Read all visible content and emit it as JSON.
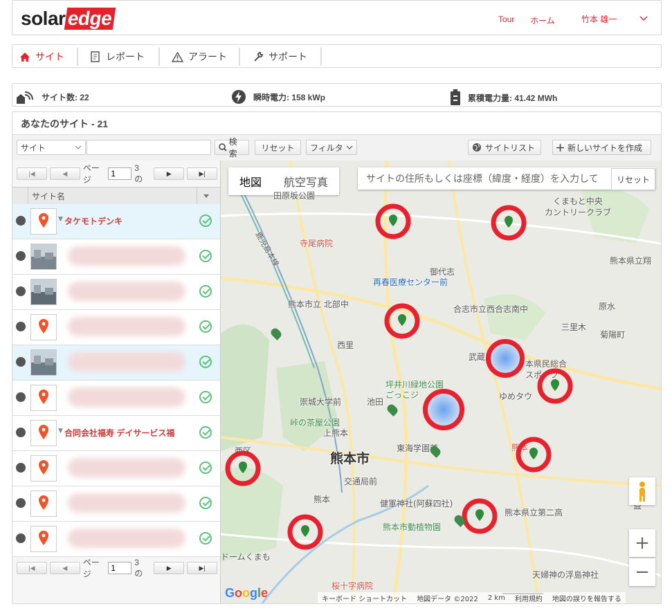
{
  "header": {
    "logo_solar": "solar",
    "logo_edge": "edge",
    "tour": "Tour",
    "home": "ホーム",
    "user": "竹本 雄一",
    "chevron": "chevron-down-icon"
  },
  "nav": {
    "site": "サイト",
    "report": "レポート",
    "alert": "アラート",
    "support": "サポート"
  },
  "stats": {
    "sites": "サイト数: 22",
    "power": "瞬時電力: 158 kWp",
    "energy": "累積電力量: 41.42 MWh"
  },
  "main": {
    "title": "あなたのサイト - 21",
    "filter_select": "サイト",
    "search_placeholder": "",
    "search_btn": "検索",
    "reset_btn": "リセット",
    "filter_btn": "フィルタ",
    "sitelist_btn": "サイトリスト",
    "new_site_btn": "新しいサイトを作成"
  },
  "list": {
    "page_label": "ページ",
    "page_value": "1",
    "page_of": "3 の",
    "column": "サイト名",
    "rows": [
      {
        "name": "タケモトデンキ",
        "thumb": "pin",
        "selected": true
      },
      {
        "name": "",
        "thumb": "photo",
        "selected": false
      },
      {
        "name": "",
        "thumb": "photo",
        "selected": false
      },
      {
        "name": "",
        "thumb": "pin",
        "selected": false
      },
      {
        "name": "",
        "thumb": "photo",
        "selected": true
      },
      {
        "name": "",
        "thumb": "pin",
        "selected": false
      },
      {
        "name": "合同会社福寿 デイサービス福",
        "thumb": "pin",
        "selected": false
      },
      {
        "name": "",
        "thumb": "pin",
        "selected": false
      },
      {
        "name": "",
        "thumb": "pin",
        "selected": false
      },
      {
        "name": "",
        "thumb": "pin",
        "selected": false
      }
    ]
  },
  "map": {
    "tab_map": "地図",
    "tab_satellite": "航空写真",
    "search_placeholder": "サイトの住所もしくは座標（緯度・経度）を入力して",
    "reset": "リセット",
    "labels": {
      "a": "田原坂公園",
      "b": "くまもと中央",
      "c": "カントリークラブ",
      "d": "熊本県立翔",
      "e": "寺尾病院",
      "f": "御代志",
      "g": "再春医療センター前",
      "h": "熊本市立 北部中",
      "i": "合志市立西合志南中",
      "j": "原水",
      "k": "三里木",
      "l": "菊陽町",
      "m": "西里",
      "n": "武蔵",
      "o": "本県民総合",
      "p": "スポーツ",
      "q": "坪井川緑地公園",
      "r": "崇城大学前",
      "s": "池田",
      "t": "ゆめタウ",
      "u": "峠の茶屋公園",
      "v": "上熊本",
      "w": "東海学園前",
      "x": "熊本",
      "y": "熊本市",
      "z": "交通局前",
      "aa": "健軍神社(阿蘇四社)",
      "ab": "熊本市動植物園",
      "ac": "熊本県立第二高",
      "ad": "ドームくまも",
      "ae": "桜十字病院",
      "af": "天婦神の浮島神社",
      "ag": "西区",
      "ah": "鹿児島本線",
      "ai": "ごっこジ",
      "aj": "熊本",
      "ak": "益"
    },
    "zoom_in": "+",
    "zoom_out": "−",
    "google": "Google",
    "footer": {
      "keys": "キーボード ショートカット",
      "data": "地図データ ©2022",
      "scale": "2 km",
      "terms": "利用規約",
      "report": "地図の誤りを報告する"
    }
  }
}
